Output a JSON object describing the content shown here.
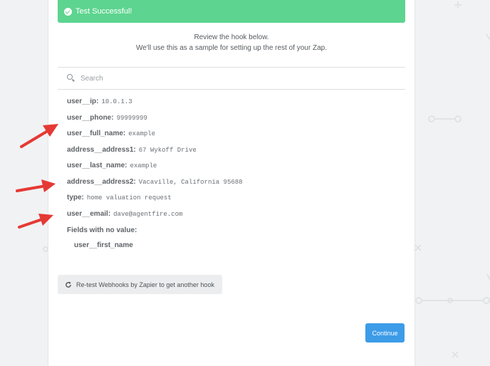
{
  "banner": {
    "text": "Test Successful!",
    "color": "#5dd48f"
  },
  "intro": {
    "line1": "Review the hook below.",
    "line2": "We'll use this as a sample for setting up the rest of your Zap."
  },
  "search": {
    "placeholder": "Search"
  },
  "fields": [
    {
      "key": "user__ip:",
      "value": "10.0.1.3"
    },
    {
      "key": "user__phone:",
      "value": "99999999"
    },
    {
      "key": "user__full_name:",
      "value": "example"
    },
    {
      "key": "address__address1:",
      "value": "67 Wykoff Drive"
    },
    {
      "key": "user__last_name:",
      "value": "example"
    },
    {
      "key": "address__address2:",
      "value": "Vacaville, California 95688"
    },
    {
      "key": "type:",
      "value": "home valuation request"
    },
    {
      "key": "user__email:",
      "value": "dave@agentfire.com"
    }
  ],
  "no_value": {
    "title": "Fields with no value:",
    "items": [
      "user__first_name"
    ]
  },
  "retest_button": {
    "label": "Re-test Webhooks by Zapier to get another hook"
  },
  "continue_button": {
    "label": "Continue",
    "color": "#3d9ce8"
  },
  "annotation_color": "#e53935"
}
